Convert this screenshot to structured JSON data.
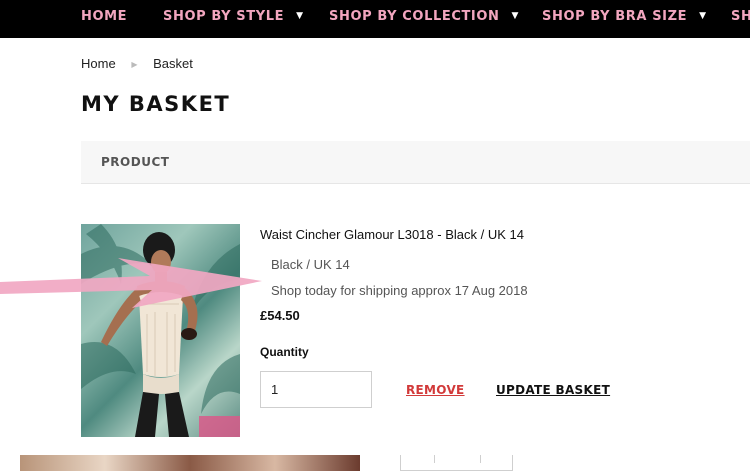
{
  "nav": {
    "items": [
      {
        "label": "HOME",
        "has_dropdown": false
      },
      {
        "label": "SHOP BY STYLE",
        "has_dropdown": true
      },
      {
        "label": "SHOP BY COLLECTION",
        "has_dropdown": true
      },
      {
        "label": "SHOP BY BRA SIZE",
        "has_dropdown": true
      },
      {
        "label": "SH",
        "has_dropdown": false
      }
    ],
    "caret_glyph": "▼",
    "text_color": "#f2a6bf",
    "background_color": "#000000"
  },
  "breadcrumb": {
    "home": "Home",
    "separator_glyph": "▶",
    "current": "Basket"
  },
  "page_title": "MY BASKET",
  "table": {
    "header_product": "PRODUCT"
  },
  "item": {
    "title": "Waist Cincher Glamour L3018 - Black / UK 14",
    "variant": "Black / UK 14",
    "shipping": "Shop today for shipping approx 17 Aug 2018",
    "price": "£54.50",
    "quantity_label": "Quantity",
    "quantity_value": "1",
    "remove_label": "REMOVE",
    "update_label": "UPDATE BASKET"
  },
  "colors": {
    "accent_pink": "#f2a6bf",
    "remove_red": "#d23a3a"
  }
}
